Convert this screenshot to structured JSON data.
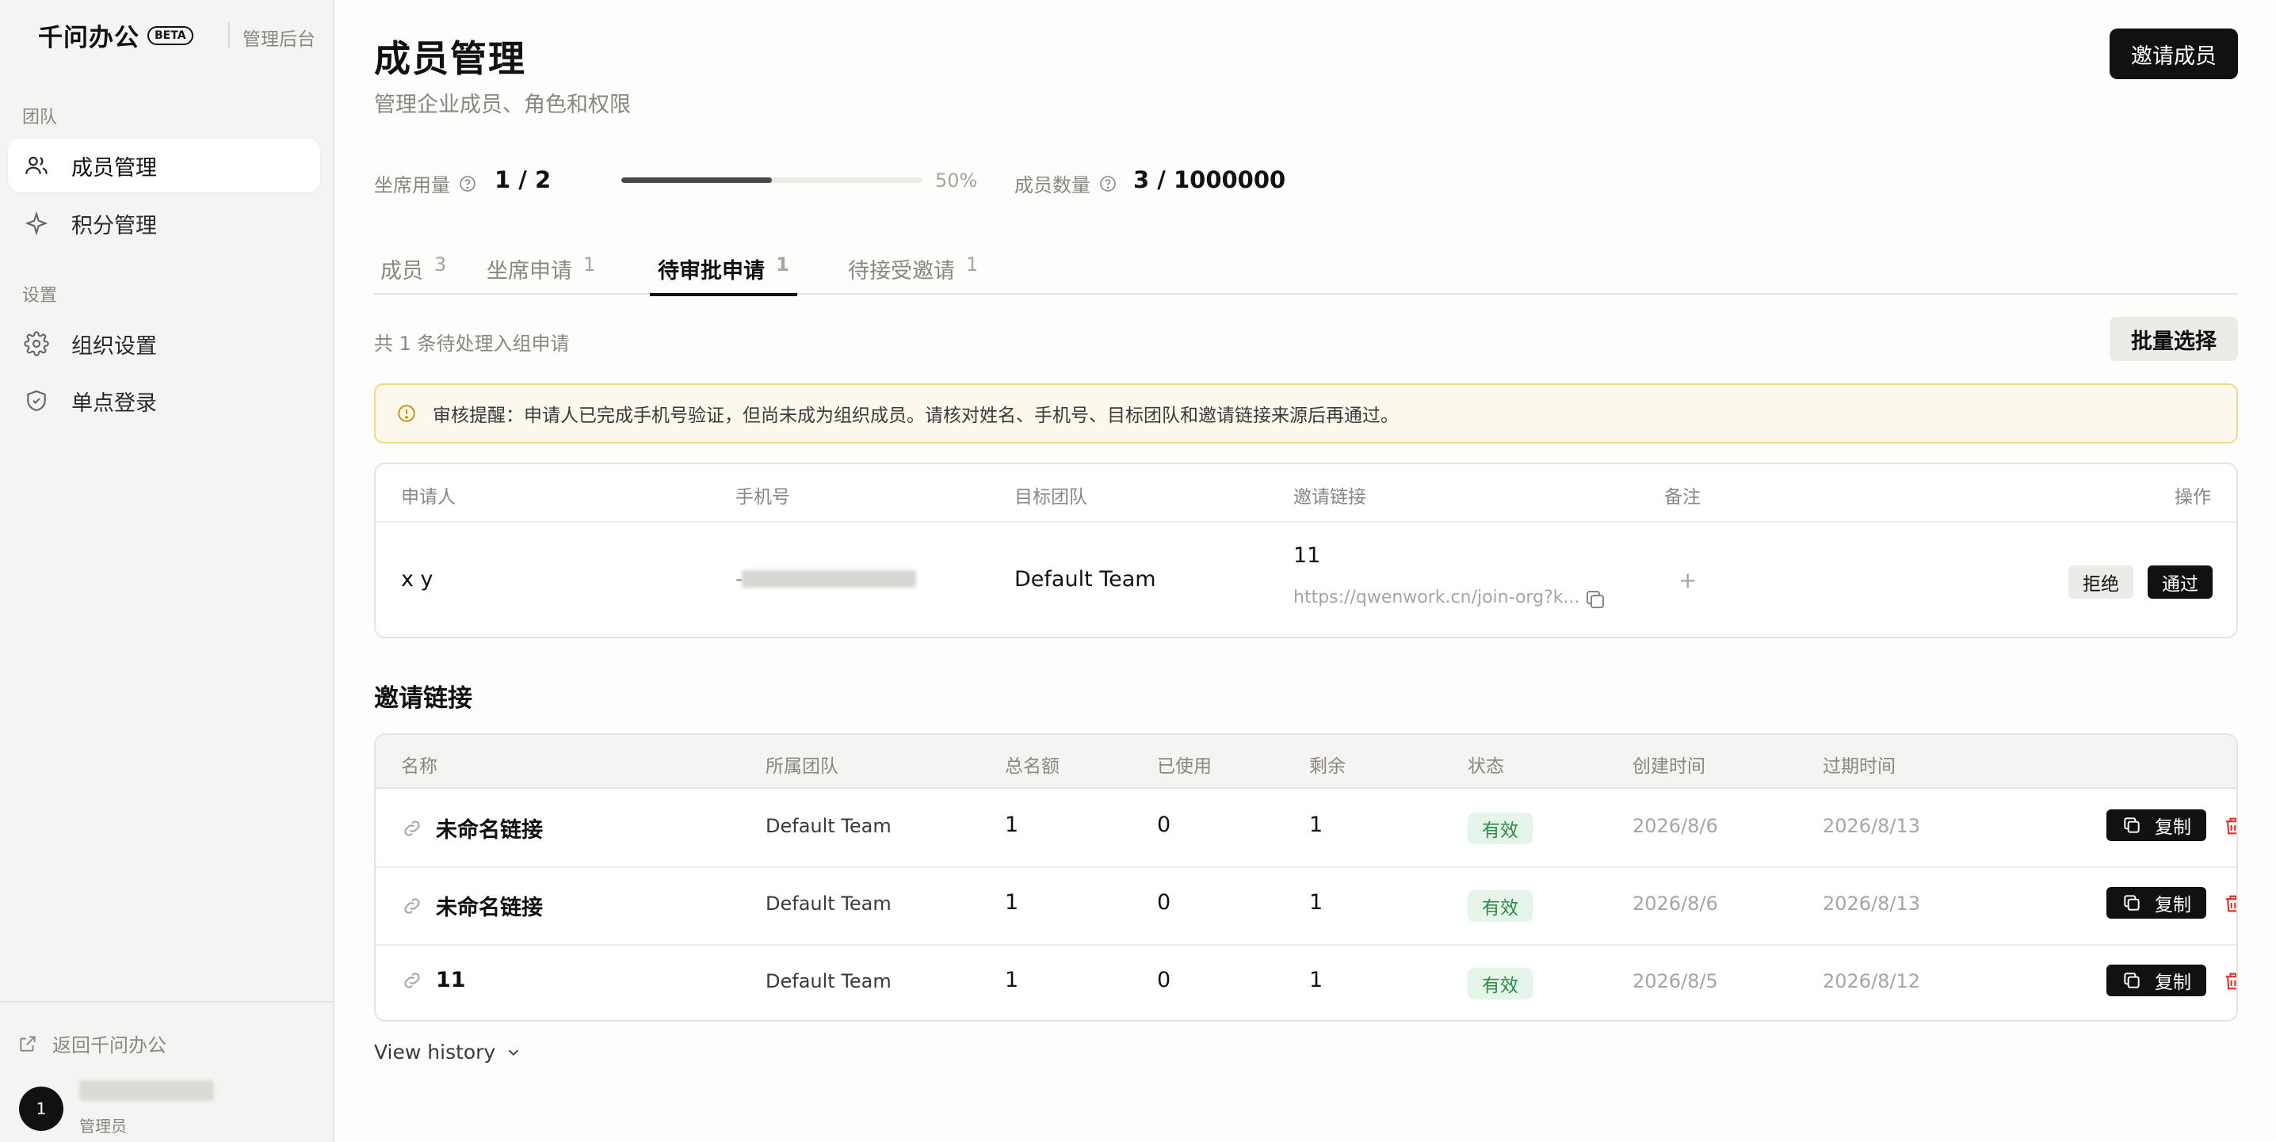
{
  "sidebar": {
    "brand_name": "千问办公",
    "beta": "BETA",
    "subtitle": "管理后台",
    "groups": [
      {
        "title": "团队",
        "items": [
          {
            "label": "成员管理",
            "icon": "users-icon",
            "active": true
          },
          {
            "label": "积分管理",
            "icon": "sparkle-icon",
            "active": false
          }
        ]
      },
      {
        "title": "设置",
        "items": [
          {
            "label": "组织设置",
            "icon": "gear-icon",
            "active": false
          },
          {
            "label": "单点登录",
            "icon": "shield-icon",
            "active": false
          }
        ]
      }
    ],
    "back_link": "返回千问办公",
    "user": {
      "avatar": "1",
      "role": "管理员"
    }
  },
  "header": {
    "title": "成员管理",
    "subtitle": "管理企业成员、角色和权限",
    "invite_button": "邀请成员"
  },
  "stats": {
    "seats_label": "坐席用量",
    "seats_value": "1 / 2",
    "seats_progress": 0.5,
    "seats_pct": "50%",
    "members_label": "成员数量",
    "members_value": "3 / 1000000"
  },
  "tabs": [
    {
      "label": "成员",
      "count": "3",
      "active": false
    },
    {
      "label": "坐席申请",
      "count": "1",
      "active": false
    },
    {
      "label": "待审批申请",
      "count": "1",
      "active": true
    },
    {
      "label": "待接受邀请",
      "count": "1",
      "active": false
    }
  ],
  "pending": {
    "total_text": "共 1 条待处理入组申请",
    "bulk_button": "批量选择",
    "notice": "审核提醒：申请人已完成手机号验证，但尚未成为组织成员。请核对姓名、手机号、目标团队和邀请链接来源后再通过。",
    "columns": [
      "申请人",
      "手机号",
      "目标团队",
      "邀请链接",
      "备注",
      "操作"
    ],
    "rows": [
      {
        "applicant": "x y",
        "phone_prefix": "-",
        "team": "Default Team",
        "link_name": "11",
        "link_url": "https://qwenwork.cn/join-org?k...",
        "note_add": "+",
        "reject": "拒绝",
        "approve": "通过"
      }
    ]
  },
  "invite_links": {
    "title": "邀请链接",
    "columns": [
      "名称",
      "所属团队",
      "总名额",
      "已使用",
      "剩余",
      "状态",
      "创建时间",
      "过期时间"
    ],
    "rows": [
      {
        "name": "未命名链接",
        "team": "Default Team",
        "total": "1",
        "used": "0",
        "remaining": "1",
        "status": "有效",
        "created": "2026/8/6",
        "expires": "2026/8/13",
        "copy": "复制"
      },
      {
        "name": "未命名链接",
        "team": "Default Team",
        "total": "1",
        "used": "0",
        "remaining": "1",
        "status": "有效",
        "created": "2026/8/6",
        "expires": "2026/8/13",
        "copy": "复制"
      },
      {
        "name": "11",
        "team": "Default Team",
        "total": "1",
        "used": "0",
        "remaining": "1",
        "status": "有效",
        "created": "2026/8/5",
        "expires": "2026/8/12",
        "copy": "复制"
      }
    ],
    "history": "View history"
  },
  "colors": {
    "accent": "#111111",
    "status_green": "#2e8a48",
    "danger": "#d93025",
    "notice_border": "#f2d98c"
  }
}
